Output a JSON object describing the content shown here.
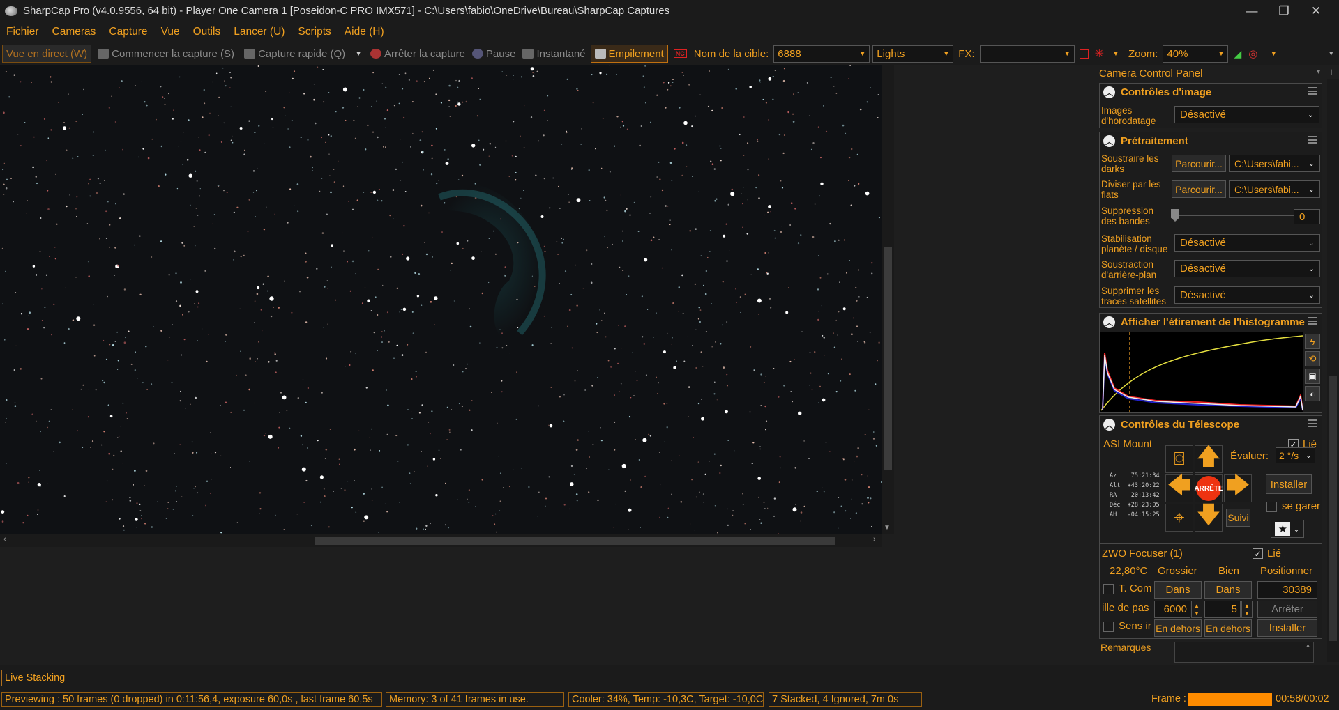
{
  "window": {
    "title": "SharpCap Pro (v4.0.9556, 64 bit) - Player One Camera 1 [Poseidon-C PRO IMX571] - C:\\Users\\fabio\\OneDrive\\Bureau\\SharpCap Captures",
    "minimize": "—",
    "maximize": "❐",
    "close": "✕"
  },
  "menu": [
    "Fichier",
    "Cameras",
    "Capture",
    "Vue",
    "Outils",
    "Lancer (U)",
    "Scripts",
    "Aide (H)"
  ],
  "toolbar": {
    "live_view": "Vue en direct (W)",
    "start_capture": "Commencer la capture (S)",
    "quick_capture": "Capture rapide (Q)",
    "stop_capture": "Arrêter la capture",
    "pause": "Pause",
    "snapshot": "Instantané",
    "stacking": "Empilement",
    "target_label": "Nom de la cible:",
    "target_value": "6888",
    "frame_type": "Lights",
    "fx_label": "FX:",
    "fx_value": "",
    "zoom_label": "Zoom:",
    "zoom_value": "40%"
  },
  "panel": {
    "title": "Camera Control Panel",
    "image_controls": {
      "header": "Contrôles d'image",
      "timestamp_label": "Images d'horodatage",
      "timestamp_value": "Désactivé"
    },
    "preprocessing": {
      "header": "Prétraitement",
      "darks_label": "Soustraire les darks",
      "darks_button": "Parcourir...",
      "darks_path": "C:\\Users\\fabi...",
      "flats_label": "Diviser par les flats",
      "flats_button": "Parcourir...",
      "flats_path": "C:\\Users\\fabi...",
      "banding_label": "Suppression des bandes",
      "banding_value": "0",
      "stabilize_label": "Stabilisation planète / disque",
      "stabilize_value": "Désactivé",
      "background_label": "Soustraction d'arrière-plan",
      "background_value": "Désactivé",
      "satellite_label": "Supprimer les traces satellites",
      "satellite_value": "Désactivé"
    },
    "histogram": {
      "header": "Afficher l'étirement de l'histogramme"
    },
    "telescope": {
      "header": "Contrôles du Télescope",
      "mount_name": "ASI Mount",
      "linked_label": "Lié",
      "stop_label": "ARRÊTE",
      "rate_label": "Évaluer:",
      "rate_value": "2 °/s",
      "setup_button": "Installer",
      "park_label": "se garer",
      "track_button": "Suivi",
      "coords": {
        "az": "Az    75:21:34",
        "alt": "Alt  +43:20:22",
        "ra": "RA    20:13:42",
        "dec": "Déc  +28:23:05",
        "ah": "AH   -04:15:25"
      }
    },
    "focuser": {
      "name": "ZWO Focuser (1)",
      "linked_label": "Lié",
      "temperature": "22,80°C",
      "coarse_label": "Grossier",
      "fine_label": "Bien",
      "position_label": "Positionner",
      "tcomp_label": "T. Com",
      "coarse_in": "Dans",
      "fine_in": "Dans",
      "position_value": "30389",
      "step_label": "ille de pas",
      "coarse_step": "6000",
      "fine_step": "5",
      "stop_button": "Arrêter",
      "reverse_label": "Sens ir",
      "coarse_out": "En dehors",
      "fine_out": "En dehors",
      "setup_button": "Installer"
    },
    "notes_label": "Remarques"
  },
  "status": {
    "live_stacking_tab": "Live Stacking",
    "preview": "Previewing : 50 frames (0 dropped) in 0:11:56,4, exposure 60,0s , last frame 60,5s",
    "memory": "Memory: 3 of 41 frames in use.",
    "cooler": "Cooler: 34%, Temp: -10,3C, Target: -10,0C",
    "stacked": "7 Stacked, 4 Ignored, 7m 0s",
    "frame_label": "Frame :",
    "frame_time": "00:58/00:02",
    "frame_progress": 1.0
  },
  "colors": {
    "accent": "#f0a020",
    "background": "#1e1e1e",
    "sky": "#0f1114",
    "nebula": "#1f6e72"
  }
}
